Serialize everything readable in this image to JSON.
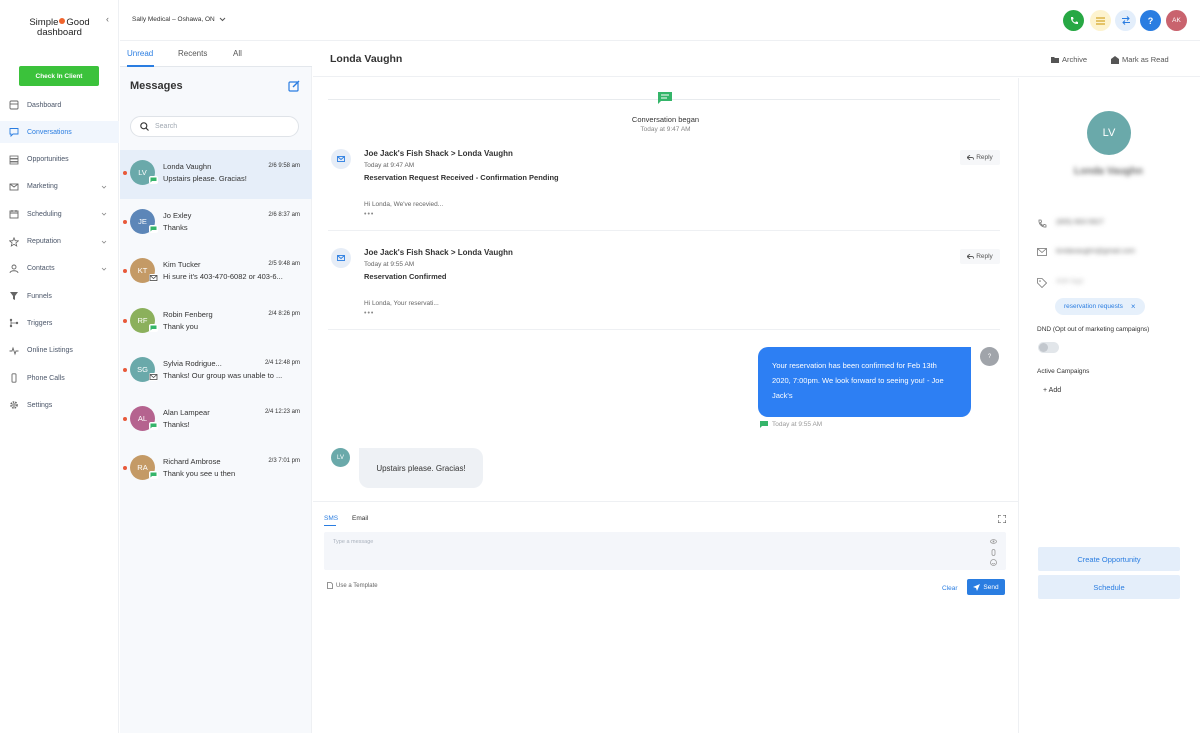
{
  "brand": {
    "logo_line1": "Simple",
    "logo_line1b": "Good",
    "logo_line2": "dashboard",
    "accent": "#2a7de1",
    "green": "#3bc23b"
  },
  "sidebar": {
    "checkin_label": "Check In Client",
    "items": [
      {
        "label": "Dashboard",
        "icon": "dashboard-icon"
      },
      {
        "label": "Conversations",
        "icon": "chat-icon",
        "active": true
      },
      {
        "label": "Opportunities",
        "icon": "filter-stack-icon"
      },
      {
        "label": "Marketing",
        "icon": "mail-icon",
        "has_children": true
      },
      {
        "label": "Scheduling",
        "icon": "calendar-icon",
        "has_children": true
      },
      {
        "label": "Reputation",
        "icon": "star-icon",
        "has_children": true
      },
      {
        "label": "Contacts",
        "icon": "person-icon",
        "has_children": true
      },
      {
        "label": "Funnels",
        "icon": "funnel-icon"
      },
      {
        "label": "Triggers",
        "icon": "trigger-icon"
      },
      {
        "label": "Online Listings",
        "icon": "pulse-icon"
      },
      {
        "label": "Phone Calls",
        "icon": "phone-icon"
      },
      {
        "label": "Settings",
        "icon": "gear-icon"
      }
    ]
  },
  "topbar": {
    "location": "Sally Medical – Oshawa, ON",
    "help": "?",
    "user_initials": "AK"
  },
  "conversations": {
    "tabs": [
      "Unread",
      "Recents",
      "All"
    ],
    "title": "Messages",
    "search_placeholder": "Search",
    "items": [
      {
        "initials": "LV",
        "name": "Londa Vaughn",
        "time": "2/6 9:58 am",
        "preview": "Upstairs please. Gracias!",
        "color": "#6aa9aa",
        "channel": "sms"
      },
      {
        "initials": "JE",
        "name": "Jo Exley",
        "time": "2/6 8:37 am",
        "preview": "Thanks",
        "color": "#5c86b8",
        "channel": "sms"
      },
      {
        "initials": "KT",
        "name": "Kim Tucker",
        "time": "2/5 9:48 am",
        "preview": "Hi sure it's 403-470-6082 or 403-6...",
        "color": "#c49a66",
        "channel": "email"
      },
      {
        "initials": "RF",
        "name": "Robin Fenberg",
        "time": "2/4 8:26 pm",
        "preview": "Thank you",
        "color": "#8bb05c",
        "channel": "sms"
      },
      {
        "initials": "SG",
        "name": "Sylvia Rodrigue...",
        "time": "2/4 12:48 pm",
        "preview": "Thanks! Our group was unable to ...",
        "color": "#6aa9aa",
        "channel": "email"
      },
      {
        "initials": "AL",
        "name": "Alan Lampear",
        "time": "2/4 12:23 am",
        "preview": "Thanks!",
        "color": "#b5638f",
        "channel": "sms"
      },
      {
        "initials": "RA",
        "name": "Richard Ambrose",
        "time": "2/3 7:01 pm",
        "preview": "Thank you see u then",
        "color": "#c49a66",
        "channel": "sms"
      }
    ]
  },
  "thread": {
    "contact_name": "Londa Vaughn",
    "archive_label": "Archive",
    "mark_read_label": "Mark as Read",
    "began_label": "Conversation began",
    "began_time": "Today at 9:47 AM",
    "emails": [
      {
        "from": "Joe Jack's Fish Shack",
        "to": "Londa Vaughn",
        "time": "Today at 9:47 AM",
        "subject": "Reservation Request Received - Confirmation Pending",
        "body": "Hi Londa, We've recevied...",
        "reply_label": "Reply"
      },
      {
        "from": "Joe Jack's Fish Shack",
        "to": "Londa Vaughn",
        "time": "Today at 9:55 AM",
        "subject": "Reservation Confirmed",
        "body": "Hi Londa, Your reservati...",
        "reply_label": "Reply"
      }
    ],
    "outgoing": {
      "text": "Your reservation has been confirmed for Feb 13th 2020, 7:00pm. We look forward to seeing you! - Joe Jack's",
      "time": "Today at 9:55 AM",
      "avatar": "?"
    },
    "incoming": {
      "text": "Upstairs please. Gracias!",
      "avatar": "LV"
    }
  },
  "composer": {
    "tabs": [
      "SMS",
      "Email"
    ],
    "placeholder": "Type a message",
    "template_label": "Use a Template",
    "clear_label": "Clear",
    "send_label": "Send"
  },
  "contact_panel": {
    "initials": "LV",
    "name": "Londa Vaughn",
    "phone": "(905) 683-5827",
    "email": "londavaughn@gmail.com",
    "tags_placeholder": "Add tags",
    "tag": "reservation requests",
    "dnd_label": "DND (Opt out of marketing campaigns)",
    "active_campaigns_label": "Active Campaigns",
    "add_label": "Add",
    "create_opportunity_label": "Create Opportunity",
    "schedule_label": "Schedule"
  }
}
